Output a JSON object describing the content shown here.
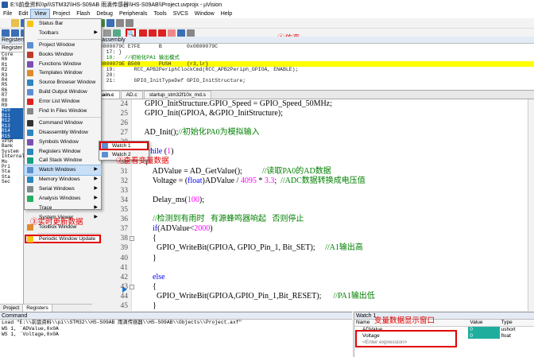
{
  "window": {
    "title": "E:\\\\前盘资料\\\\pi\\\\STM32\\\\HS-S09AB 雨滴传感器\\\\HS-S09AB\\\\Project.uvprojx - µVision"
  },
  "menubar": [
    "File",
    "Edit",
    "View",
    "Project",
    "Flash",
    "Debug",
    "Peripherals",
    "Tools",
    "SVCS",
    "Window",
    "Help"
  ],
  "toolbar": {
    "target": "GPIO_mode",
    "sim_icon": "🔍"
  },
  "annotations": {
    "sim": "①仿真",
    "watch": "②查看变量数据",
    "periodic": "③实时更新数据",
    "watch_window": "变量数据显示窗口"
  },
  "view_menu": [
    {
      "label": "Status Bar",
      "icon": "check"
    },
    {
      "label": "Toolbars",
      "icon": "none",
      "submenu": true
    },
    {
      "sep": true
    },
    {
      "label": "Project Window",
      "icon": "project"
    },
    {
      "label": "Books Window",
      "icon": "books"
    },
    {
      "label": "Functions Window",
      "icon": "functions"
    },
    {
      "label": "Templates Window",
      "icon": "templates"
    },
    {
      "label": "Source Browser Window",
      "icon": "browser"
    },
    {
      "label": "Build Output Window",
      "icon": "build"
    },
    {
      "label": "Error List Window",
      "icon": "error"
    },
    {
      "label": "Find In Files Window",
      "icon": "find"
    },
    {
      "sep": true
    },
    {
      "label": "Command Window",
      "icon": "command"
    },
    {
      "label": "Disassembly Window",
      "icon": "disasm"
    },
    {
      "label": "Symbols Window",
      "icon": "symbols"
    },
    {
      "label": "Registers Window",
      "icon": "registers"
    },
    {
      "label": "Call Stack Window",
      "icon": "callstack"
    },
    {
      "label": "Watch Windows",
      "icon": "watch",
      "submenu": true,
      "selected": true
    },
    {
      "label": "Memory Windows",
      "icon": "memory",
      "submenu": true
    },
    {
      "label": "Serial Windows",
      "icon": "serial",
      "submenu": true
    },
    {
      "label": "Analysis Windows",
      "icon": "analysis",
      "submenu": true
    },
    {
      "label": "Trace",
      "icon": "none",
      "submenu": true
    },
    {
      "label": "System Viewer",
      "icon": "none",
      "submenu": true
    },
    {
      "label": "Toolbox Window",
      "icon": "toolbox"
    },
    {
      "sep": true
    },
    {
      "label": "Periodic Window Update",
      "icon": "check",
      "boxed": true
    }
  ],
  "watch_submenu": [
    "Watch 1",
    "Watch 2"
  ],
  "registers_panel": {
    "title": "Registers",
    "tab": "Register",
    "lines": [
      "Core",
      "R0",
      "R1",
      "R2",
      "R3",
      "R4",
      "R5",
      "R6",
      "R7",
      "R8",
      "R9",
      "R10",
      "R11",
      "R12",
      "R13",
      "R14",
      "R15",
      "xPSR",
      "Bank",
      "System",
      "Internal",
      "Mo",
      "Pri",
      "Sta",
      "Sta",
      "Sec"
    ]
  },
  "left_tabs": [
    "Project",
    "Registers"
  ],
  "disassembly": {
    "title": "Disassembly",
    "lines": [
      {
        "t": "0x0800079C E7FE      B        0x0800079C",
        "k": "n"
      },
      {
        "t": "    17: }",
        "k": "n"
      },
      {
        "t": "    18:   //初始化PA1 输出模式",
        "k": "cmt"
      },
      {
        "t": "0x0800079E B508      PUSH     {r3,lr}",
        "k": "cur"
      },
      {
        "t": "    19:      RCC_APB2PeriphClockCmd(RCC_APB2Periph_GPIOA, ENABLE);",
        "k": "n"
      },
      {
        "t": "    20:",
        "k": "n"
      },
      {
        "t": "    21:      GPIO_InitTypeDef GPIO_InitStructure;",
        "k": "n"
      }
    ]
  },
  "editor_tabs": [
    "main.c",
    "AD.c",
    "startup_stm32f10x_md.s"
  ],
  "code_lines": [
    {
      "n": "24",
      "segs": [
        [
          "",
          "    GPIO_InitStructure.GPIO_Speed = GPIO_Speed_50MHz;"
        ]
      ]
    },
    {
      "n": "25",
      "segs": [
        [
          "",
          "    GPIO_Init(GPIOA, &GPIO_InitStructure);"
        ]
      ]
    },
    {
      "n": "26",
      "segs": [
        [
          "",
          ""
        ]
      ]
    },
    {
      "n": "27",
      "segs": [
        [
          "",
          "    AD_Init();"
        ],
        [
          "cm",
          "//初始化PA0为模拟输入"
        ]
      ]
    },
    {
      "n": "28",
      "segs": [
        [
          "",
          ""
        ]
      ]
    },
    {
      "n": "29",
      "segs": [
        [
          "kw",
          "    while"
        ],
        [
          "",
          " ("
        ],
        [
          "num",
          "1"
        ],
        [
          "",
          ")"
        ]
      ],
      "fold": "-"
    },
    {
      "n": "30",
      "segs": [
        [
          "",
          "    {"
        ]
      ]
    },
    {
      "n": "31",
      "segs": [
        [
          "",
          "        ADValue = AD_GetValue();          "
        ],
        [
          "cm",
          "//读取PA0的AD数据"
        ]
      ]
    },
    {
      "n": "32",
      "segs": [
        [
          "",
          "        Voltage = ("
        ],
        [
          "kw",
          "float"
        ],
        [
          "",
          ")ADValue / "
        ],
        [
          "num",
          "4095"
        ],
        [
          "",
          " * "
        ],
        [
          "num",
          "3.3"
        ],
        [
          "",
          ";  "
        ],
        [
          "cm",
          "//ADC数据转换成电压值"
        ]
      ]
    },
    {
      "n": "33",
      "segs": [
        [
          "",
          ""
        ]
      ]
    },
    {
      "n": "34",
      "segs": [
        [
          "",
          "        Delay_ms("
        ],
        [
          "num",
          "100"
        ],
        [
          "",
          ");"
        ]
      ]
    },
    {
      "n": "35",
      "segs": [
        [
          "",
          ""
        ]
      ]
    },
    {
      "n": "36",
      "segs": [
        [
          "cm",
          "        //检测到有雨时   有源蜂鸣器响起   否则停止"
        ]
      ]
    },
    {
      "n": "37",
      "segs": [
        [
          "kw",
          "        if"
        ],
        [
          "",
          "(ADValue<"
        ],
        [
          "num",
          "2000"
        ],
        [
          "",
          ")"
        ]
      ]
    },
    {
      "n": "38",
      "segs": [
        [
          "",
          "        {"
        ]
      ],
      "fold": "-"
    },
    {
      "n": "39",
      "segs": [
        [
          "",
          "          GPIO_WriteBit(GPIOA, GPIO_Pin_1, Bit_SET);     "
        ],
        [
          "cm",
          "//A1输出高"
        ]
      ]
    },
    {
      "n": "40",
      "segs": [
        [
          "",
          "        }"
        ]
      ]
    },
    {
      "n": "41",
      "segs": [
        [
          "",
          ""
        ]
      ]
    },
    {
      "n": "42",
      "segs": [
        [
          "kw",
          "        else"
        ]
      ]
    },
    {
      "n": "43",
      "segs": [
        [
          "",
          "        {"
        ]
      ],
      "fold": "-"
    },
    {
      "n": "44",
      "segs": [
        [
          "",
          "          GPIO_WriteBit(GPIOA,GPIO_Pin_1,Bit_RESET);      "
        ],
        [
          "cm",
          "//PA1输出低"
        ]
      ]
    },
    {
      "n": "45",
      "segs": [
        [
          "",
          "        }"
        ]
      ]
    },
    {
      "n": "46",
      "segs": [
        [
          "",
          ""
        ]
      ]
    },
    {
      "n": "47",
      "segs": [
        [
          "",
          "    }"
        ]
      ]
    },
    {
      "n": "48",
      "segs": [
        [
          "",
          "}"
        ]
      ]
    },
    {
      "n": "49",
      "segs": [
        [
          "",
          ""
        ]
      ]
    }
  ],
  "command": {
    "title": "Command",
    "lines": [
      "Load \"E:\\\\前盘资料\\\\pi\\\\STM32\\\\HS-S09AB 雨滴传感器\\\\HS-S09AB\\\\Objects\\\\Project.axf\"",
      "WS 1, `ADValue,0x0A",
      "WS 1, `Voltage,0x0A"
    ]
  },
  "watch": {
    "title": "Watch 1",
    "columns": [
      "Name",
      "Value",
      "Type"
    ],
    "rows": [
      {
        "name": "ADValue",
        "value": "0",
        "type": "ushort"
      },
      {
        "name": "Voltage",
        "value": "0",
        "type": "float"
      }
    ],
    "placeholder": "<Enter expression>"
  },
  "colors": {
    "accent": "#e00000",
    "selection": "#1e62b0",
    "watch_value": "#1fae9e",
    "current_line": "#ffff00"
  }
}
